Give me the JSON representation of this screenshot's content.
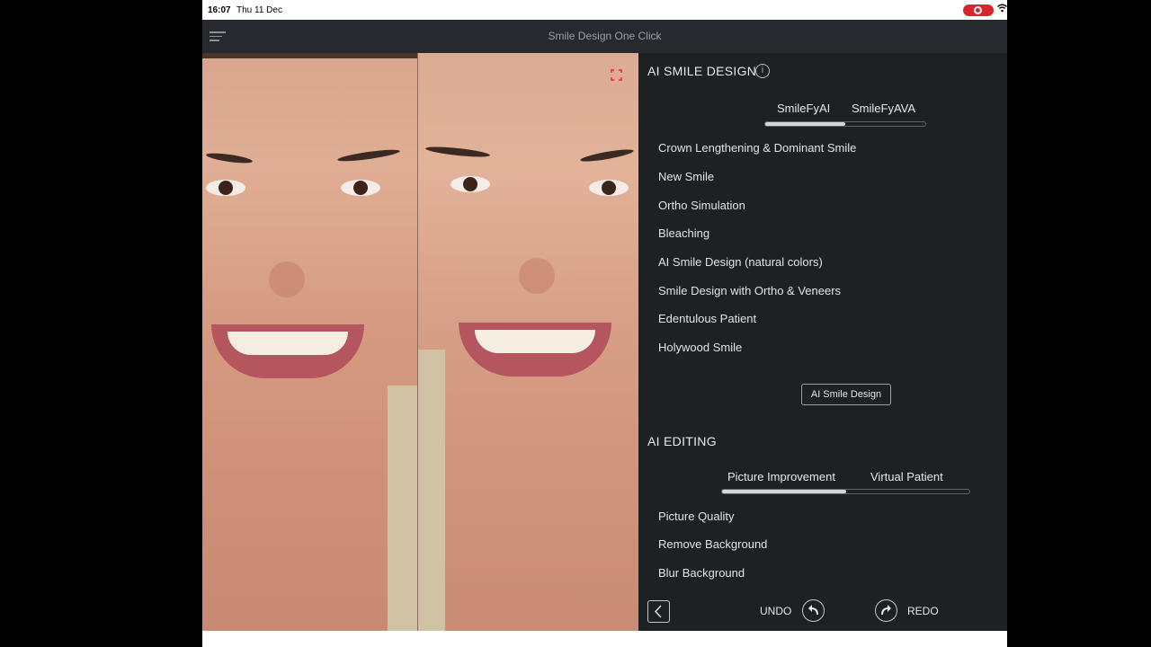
{
  "status_bar": {
    "time": "16:07",
    "date": "Thu 11 Dec"
  },
  "header": {
    "title": "Smile Design One Click"
  },
  "ai_smile_design": {
    "title": "AI SMILE DESIGN",
    "tabs": [
      {
        "label": "SmileFyAI"
      },
      {
        "label": "SmileFyAVA"
      }
    ],
    "active_tab_fraction": 0.5,
    "options": [
      "Crown Lengthening & Dominant Smile",
      "New Smile",
      "Ortho Simulation",
      "Bleaching",
      "AI Smile Design (natural colors)",
      "Smile Design with Ortho & Veneers",
      "Edentulous Patient",
      "Holywood Smile"
    ],
    "button_label": "AI Smile Design"
  },
  "ai_editing": {
    "title": "AI EDITING",
    "tabs": [
      {
        "label": "Picture Improvement"
      },
      {
        "label": "Virtual Patient"
      }
    ],
    "active_tab_fraction": 0.5,
    "options": [
      "Picture Quality",
      "Remove Background",
      "Blur Background"
    ]
  },
  "toolbar": {
    "undo_label": "UNDO",
    "redo_label": "REDO"
  },
  "colors": {
    "background": "#1e2124",
    "accent": "#d4d7da",
    "record": "#d7262e"
  }
}
